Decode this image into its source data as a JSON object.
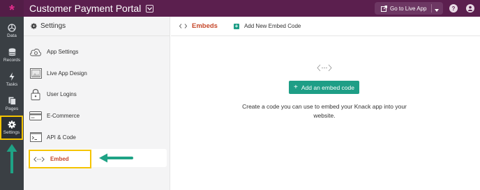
{
  "topbar": {
    "logo_glyph": "*",
    "app_title": "Customer Payment Portal",
    "go_live_label": "Go to Live App",
    "help_glyph": "?"
  },
  "leftnav": {
    "items": [
      {
        "label": "Data",
        "icon": "data-icon"
      },
      {
        "label": "Records",
        "icon": "records-icon"
      },
      {
        "label": "Tasks",
        "icon": "tasks-icon"
      },
      {
        "label": "Pages",
        "icon": "pages-icon"
      },
      {
        "label": "Settings",
        "icon": "gear-icon",
        "active": true
      }
    ]
  },
  "settings_panel": {
    "title": "Settings",
    "items": [
      {
        "label": "App Settings",
        "icon": "app-settings-icon"
      },
      {
        "label": "Live App Design",
        "icon": "design-icon"
      },
      {
        "label": "User Logins",
        "icon": "lock-icon"
      },
      {
        "label": "E-Commerce",
        "icon": "ecommerce-icon"
      },
      {
        "label": "API & Code",
        "icon": "terminal-icon"
      },
      {
        "label": "Embed",
        "icon": "embed-icon",
        "active": true
      }
    ]
  },
  "main": {
    "tabs": [
      {
        "label": "Embeds",
        "active": true
      },
      {
        "label": "Add New Embed Code"
      }
    ],
    "add_button_label": "Add an embed code",
    "add_button_glyph": "+",
    "description": "Create a code you can use to embed your Knack app into your website."
  },
  "colors": {
    "topbar": "#5b1f4e",
    "accent": "#1e9e86",
    "highlight": "#f5c400",
    "active_text": "#c6472a"
  }
}
